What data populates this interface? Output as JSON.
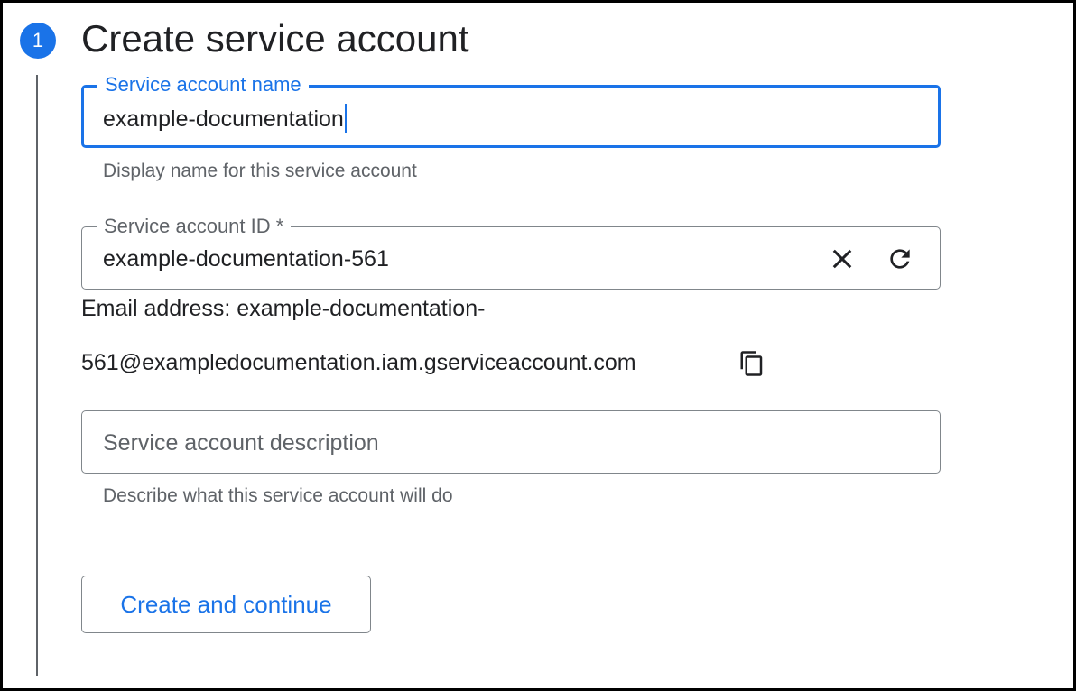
{
  "step": {
    "number": "1",
    "title": "Create service account"
  },
  "name_field": {
    "label": "Service account name",
    "value": "example-documentation",
    "hint": "Display name for this service account"
  },
  "id_field": {
    "label": "Service account ID *",
    "value": "example-documentation-561",
    "clear_icon": "close-icon",
    "refresh_icon": "refresh-icon"
  },
  "email": {
    "line1": "Email address: example-documentation-",
    "line2": "561@exampledocumentation.iam.gserviceaccount.com",
    "copy_icon": "copy-icon"
  },
  "description_field": {
    "placeholder": "Service account description",
    "value": "",
    "hint": "Describe what this service account will do"
  },
  "actions": {
    "create_label": "Create and continue"
  },
  "colors": {
    "accent": "#1a73e8",
    "text": "#202124",
    "secondary_text": "#5f6368",
    "border": "#80868b"
  }
}
